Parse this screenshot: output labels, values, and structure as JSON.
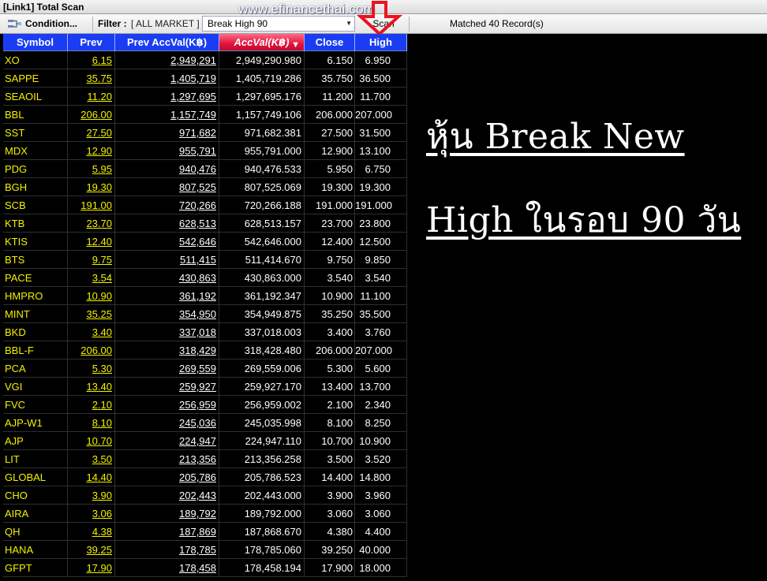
{
  "window": {
    "title": "[Link1] Total Scan"
  },
  "toolbar": {
    "condition_label": "Condition...",
    "filter_label": "Filter :",
    "filter_value": "[ ALL MARKET ]",
    "combo_value": "Break High 90",
    "scan_label": "Scan",
    "matched_text": "Matched 40 Record(s)"
  },
  "watermark": "www.efinancethai.com",
  "arrow_color": "#e8141e",
  "table": {
    "headers": {
      "symbol": "Symbol",
      "prev": "Prev",
      "prev_acc_val": "Prev AccVal(K฿)",
      "acc_val": "AccVal(K฿)",
      "close": "Close",
      "high": "High"
    },
    "sorted_column": "acc_val",
    "header_color": "#1a3df4",
    "sorted_header_color": "#e0143c",
    "symbol_color": "#f2f200",
    "rows": [
      {
        "symbol": "XO",
        "prev": "6.15",
        "prev_acc_val": "2,949,291",
        "acc_val": "2,949,290.980",
        "close": "6.150",
        "high": "6.950"
      },
      {
        "symbol": "SAPPE",
        "prev": "35.75",
        "prev_acc_val": "1,405,719",
        "acc_val": "1,405,719.286",
        "close": "35.750",
        "high": "36.500"
      },
      {
        "symbol": "SEAOIL",
        "prev": "11.20",
        "prev_acc_val": "1,297,695",
        "acc_val": "1,297,695.176",
        "close": "11.200",
        "high": "11.700"
      },
      {
        "symbol": "BBL",
        "prev": "206.00",
        "prev_acc_val": "1,157,749",
        "acc_val": "1,157,749.106",
        "close": "206.000",
        "high": "207.000"
      },
      {
        "symbol": "SST",
        "prev": "27.50",
        "prev_acc_val": "971,682",
        "acc_val": "971,682.381",
        "close": "27.500",
        "high": "31.500"
      },
      {
        "symbol": "MDX",
        "prev": "12.90",
        "prev_acc_val": "955,791",
        "acc_val": "955,791.000",
        "close": "12.900",
        "high": "13.100"
      },
      {
        "symbol": "PDG",
        "prev": "5.95",
        "prev_acc_val": "940,476",
        "acc_val": "940,476.533",
        "close": "5.950",
        "high": "6.750"
      },
      {
        "symbol": "BGH",
        "prev": "19.30",
        "prev_acc_val": "807,525",
        "acc_val": "807,525.069",
        "close": "19.300",
        "high": "19.300"
      },
      {
        "symbol": "SCB",
        "prev": "191.00",
        "prev_acc_val": "720,266",
        "acc_val": "720,266.188",
        "close": "191.000",
        "high": "191.000"
      },
      {
        "symbol": "KTB",
        "prev": "23.70",
        "prev_acc_val": "628,513",
        "acc_val": "628,513.157",
        "close": "23.700",
        "high": "23.800"
      },
      {
        "symbol": "KTIS",
        "prev": "12.40",
        "prev_acc_val": "542,646",
        "acc_val": "542,646.000",
        "close": "12.400",
        "high": "12.500"
      },
      {
        "symbol": "BTS",
        "prev": "9.75",
        "prev_acc_val": "511,415",
        "acc_val": "511,414.670",
        "close": "9.750",
        "high": "9.850"
      },
      {
        "symbol": "PACE",
        "prev": "3.54",
        "prev_acc_val": "430,863",
        "acc_val": "430,863.000",
        "close": "3.540",
        "high": "3.540"
      },
      {
        "symbol": "HMPRO",
        "prev": "10.90",
        "prev_acc_val": "361,192",
        "acc_val": "361,192.347",
        "close": "10.900",
        "high": "11.100"
      },
      {
        "symbol": "MINT",
        "prev": "35.25",
        "prev_acc_val": "354,950",
        "acc_val": "354,949.875",
        "close": "35.250",
        "high": "35.500"
      },
      {
        "symbol": "BKD",
        "prev": "3.40",
        "prev_acc_val": "337,018",
        "acc_val": "337,018.003",
        "close": "3.400",
        "high": "3.760"
      },
      {
        "symbol": "BBL-F",
        "prev": "206.00",
        "prev_acc_val": "318,429",
        "acc_val": "318,428.480",
        "close": "206.000",
        "high": "207.000"
      },
      {
        "symbol": "PCA",
        "prev": "5.30",
        "prev_acc_val": "269,559",
        "acc_val": "269,559.006",
        "close": "5.300",
        "high": "5.600"
      },
      {
        "symbol": "VGI",
        "prev": "13.40",
        "prev_acc_val": "259,927",
        "acc_val": "259,927.170",
        "close": "13.400",
        "high": "13.700"
      },
      {
        "symbol": "FVC",
        "prev": "2.10",
        "prev_acc_val": "256,959",
        "acc_val": "256,959.002",
        "close": "2.100",
        "high": "2.340"
      },
      {
        "symbol": "AJP-W1",
        "prev": "8.10",
        "prev_acc_val": "245,036",
        "acc_val": "245,035.998",
        "close": "8.100",
        "high": "8.250"
      },
      {
        "symbol": "AJP",
        "prev": "10.70",
        "prev_acc_val": "224,947",
        "acc_val": "224,947.110",
        "close": "10.700",
        "high": "10.900"
      },
      {
        "symbol": "LIT",
        "prev": "3.50",
        "prev_acc_val": "213,356",
        "acc_val": "213,356.258",
        "close": "3.500",
        "high": "3.520"
      },
      {
        "symbol": "GLOBAL",
        "prev": "14.40",
        "prev_acc_val": "205,786",
        "acc_val": "205,786.523",
        "close": "14.400",
        "high": "14.800"
      },
      {
        "symbol": "CHO",
        "prev": "3.90",
        "prev_acc_val": "202,443",
        "acc_val": "202,443.000",
        "close": "3.900",
        "high": "3.960"
      },
      {
        "symbol": "AIRA",
        "prev": "3.06",
        "prev_acc_val": "189,792",
        "acc_val": "189,792.000",
        "close": "3.060",
        "high": "3.060"
      },
      {
        "symbol": "QH",
        "prev": "4.38",
        "prev_acc_val": "187,869",
        "acc_val": "187,868.670",
        "close": "4.380",
        "high": "4.400"
      },
      {
        "symbol": "HANA",
        "prev": "39.25",
        "prev_acc_val": "178,785",
        "acc_val": "178,785.060",
        "close": "39.250",
        "high": "40.000"
      },
      {
        "symbol": "GFPT",
        "prev": "17.90",
        "prev_acc_val": "178,458",
        "acc_val": "178,458.194",
        "close": "17.900",
        "high": "18.000"
      }
    ]
  },
  "caption": {
    "line1": "หุ้น Break New",
    "line2": "High ในรอบ 90 วัน"
  }
}
